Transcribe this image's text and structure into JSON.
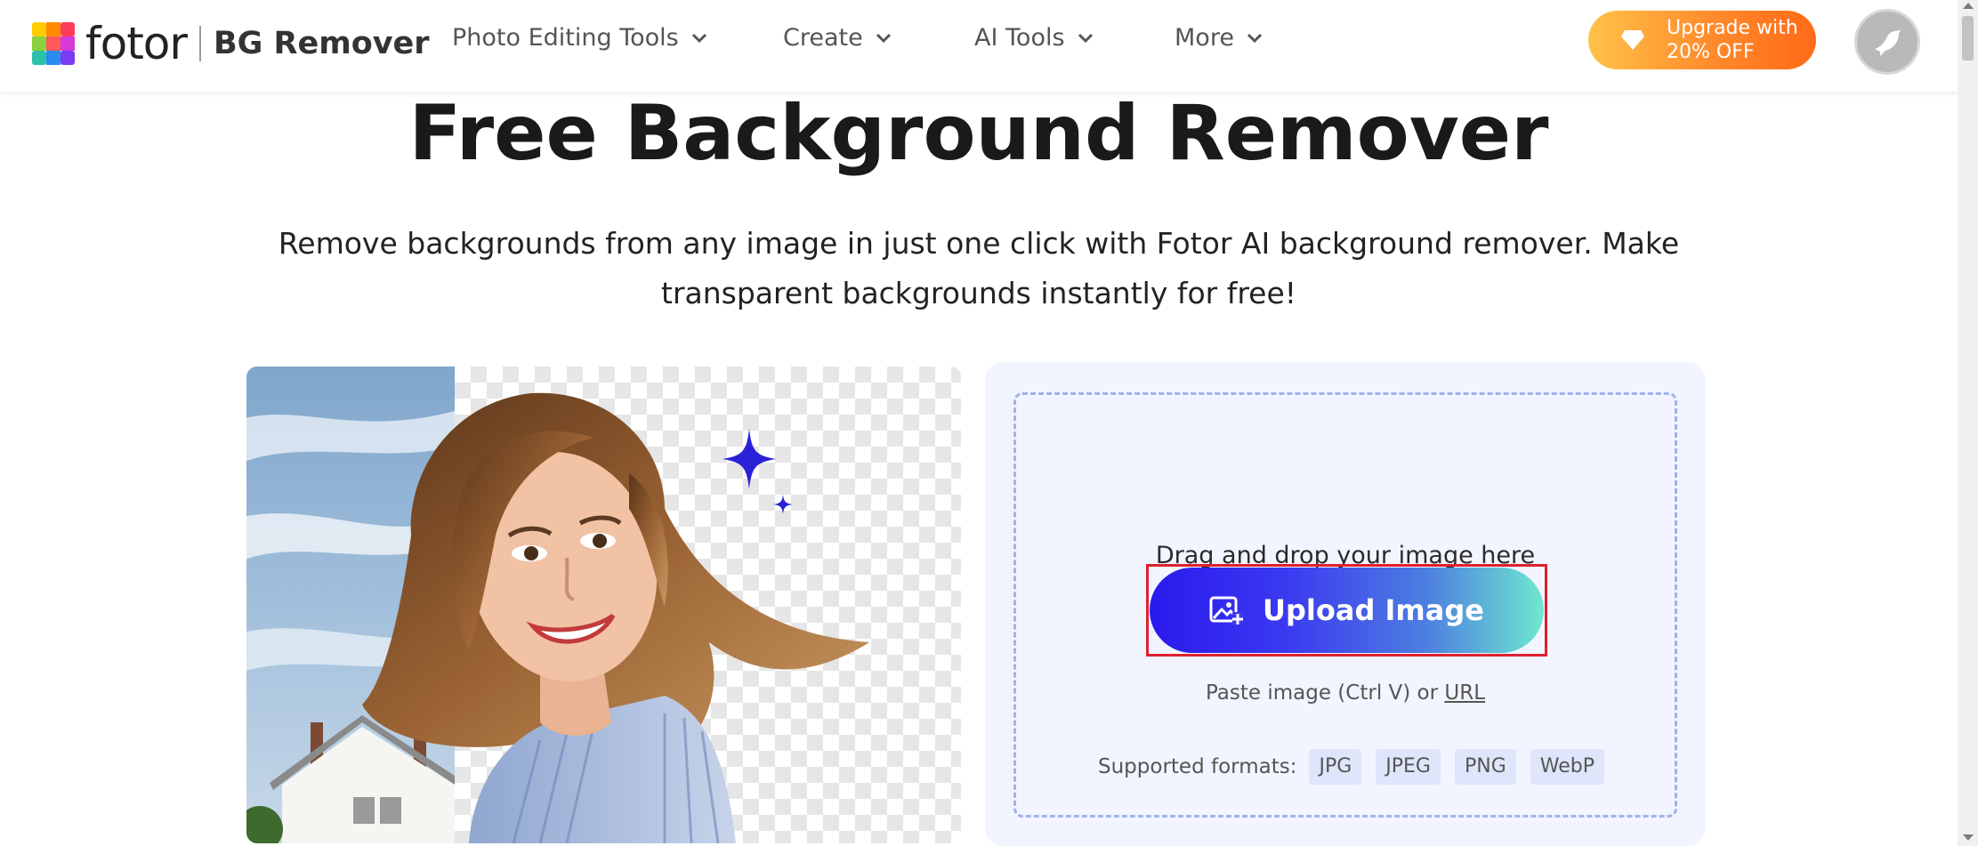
{
  "header": {
    "logo_text": "fotor",
    "product": "BG Remover",
    "nav": [
      {
        "label": "Photo Editing Tools"
      },
      {
        "label": "Create"
      },
      {
        "label": "AI Tools"
      },
      {
        "label": "More"
      }
    ],
    "upgrade_line1": "Upgrade with",
    "upgrade_line2": "20% OFF"
  },
  "hero": {
    "title": "Free Background Remover",
    "subtitle_line1": "Remove backgrounds from any image in just one click with Fotor AI background remover. Make",
    "subtitle_line2": "transparent backgrounds instantly for free!"
  },
  "upload": {
    "drag_text": "Drag and drop your image here",
    "button_label": "Upload Image",
    "paste_prefix": "Paste image (Ctrl V) or ",
    "paste_link": "URL",
    "formats_label": "Supported formats:",
    "formats": [
      "JPG",
      "JPEG",
      "PNG",
      "WebP"
    ]
  },
  "colors": {
    "upgrade_start": "#ffc24a",
    "upgrade_end": "#ff6a18",
    "upload_start": "#2a19ee",
    "upload_end": "#6ee8cf",
    "highlight_outline": "#e0202d",
    "card_bg": "#f2f5ff"
  }
}
